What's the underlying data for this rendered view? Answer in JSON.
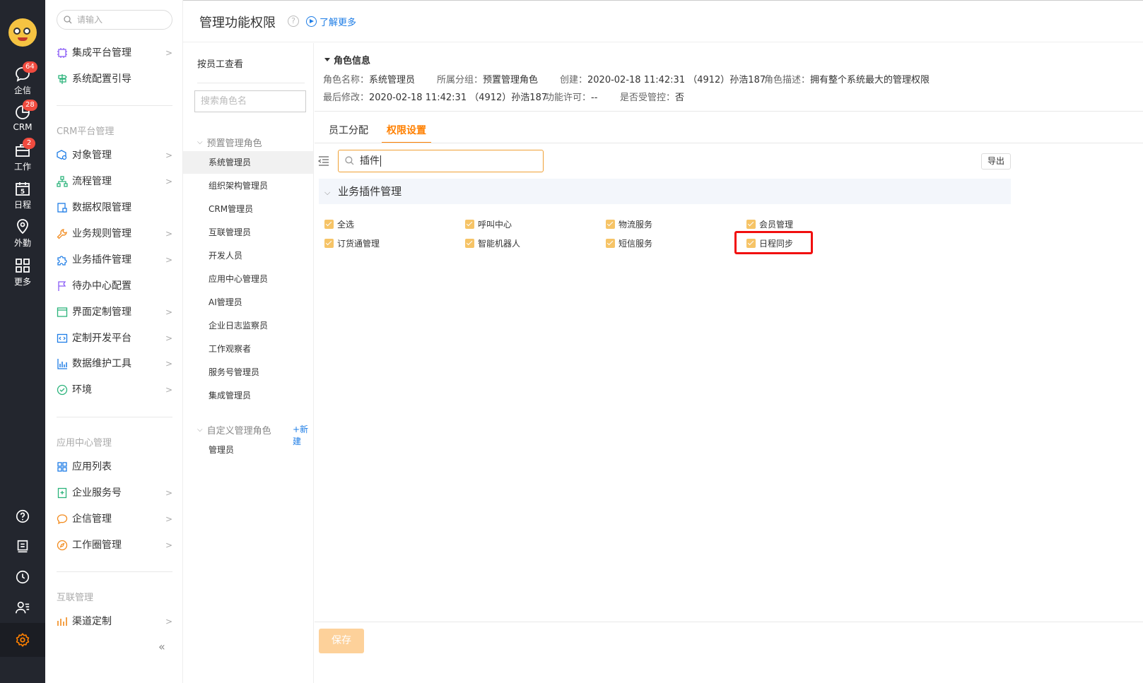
{
  "rail": {
    "items": [
      {
        "label": "企信",
        "badge": "64"
      },
      {
        "label": "CRM",
        "badge": "28"
      },
      {
        "label": "工作",
        "badge": "2"
      },
      {
        "label": "日程",
        "badge": "",
        "day": "5"
      },
      {
        "label": "外勤",
        "badge": ""
      },
      {
        "label": "更多",
        "badge": ""
      }
    ]
  },
  "menu": {
    "search_placeholder": "请输入",
    "top_items": [
      {
        "label": "集成平台管理"
      },
      {
        "label": "系统配置引导"
      }
    ],
    "crm_section": "CRM平台管理",
    "crm_items": [
      {
        "label": "对象管理"
      },
      {
        "label": "流程管理"
      },
      {
        "label": "数据权限管理"
      },
      {
        "label": "业务规则管理"
      },
      {
        "label": "业务插件管理"
      },
      {
        "label": "待办中心配置"
      },
      {
        "label": "界面定制管理"
      },
      {
        "label": "定制开发平台"
      },
      {
        "label": "数据维护工具"
      },
      {
        "label": "环境"
      }
    ],
    "app_section": "应用中心管理",
    "app_items": [
      {
        "label": "应用列表"
      },
      {
        "label": "企业服务号"
      },
      {
        "label": "企信管理"
      },
      {
        "label": "工作圈管理"
      }
    ],
    "interconnect_section": "互联管理",
    "interconnect_items": [
      {
        "label": "渠道定制"
      }
    ],
    "collapse": "«"
  },
  "header": {
    "title": "管理功能权限",
    "learn_more": "了解更多",
    "help": "?"
  },
  "roles": {
    "by_employee": "按员工查看",
    "search_placeholder": "搜索角色名",
    "preset_group": "预置管理角色",
    "preset_roles": [
      "系统管理员",
      "组织架构管理员",
      "CRM管理员",
      "互联管理员",
      "开发人员",
      "应用中心管理员",
      "AI管理员",
      "企业日志监察员",
      "工作观察者",
      "服务号管理员",
      "集成管理员"
    ],
    "custom_group": "自定义管理角色",
    "new_link": "+新建",
    "custom_roles": [
      "管理员"
    ]
  },
  "role_info": {
    "title": "角色信息",
    "name_label": "角色名称：",
    "name": "系统管理员",
    "group_label": "所属分组：",
    "group": "预置管理角色",
    "created_label": "创建：",
    "created": "2020-02-18 11:42:31 （4912）孙浩187",
    "desc_label": "角色描述：",
    "desc": "拥有整个系统最大的管理权限",
    "modified_label": "最后修改：",
    "modified": "2020-02-18 11:42:31 （4912）孙浩187",
    "license_label": "功能许可：",
    "license": "--",
    "controlled_label": "是否受管控：",
    "controlled": "否"
  },
  "tabs": [
    {
      "label": "员工分配",
      "active": false
    },
    {
      "label": "权限设置",
      "active": true
    }
  ],
  "permission": {
    "search_value": "插件",
    "export": "导出",
    "section_title": "业务插件管理",
    "checkboxes": [
      {
        "label": "全选",
        "checked": true
      },
      {
        "label": "呼叫中心",
        "checked": true
      },
      {
        "label": "物流服务",
        "checked": true
      },
      {
        "label": "会员管理",
        "checked": true
      },
      {
        "label": "订货通管理",
        "checked": true
      },
      {
        "label": "智能机器人",
        "checked": true
      },
      {
        "label": "短信服务",
        "checked": true
      },
      {
        "label": "日程同步",
        "checked": true
      }
    ],
    "save": "保存"
  },
  "colors": {
    "accent": "#ff8000",
    "link": "#1e7de6",
    "rail_bg": "#23262e",
    "checkbox": "#f6c467",
    "highlight": "#f10f0f",
    "badge": "#f04b3f"
  }
}
